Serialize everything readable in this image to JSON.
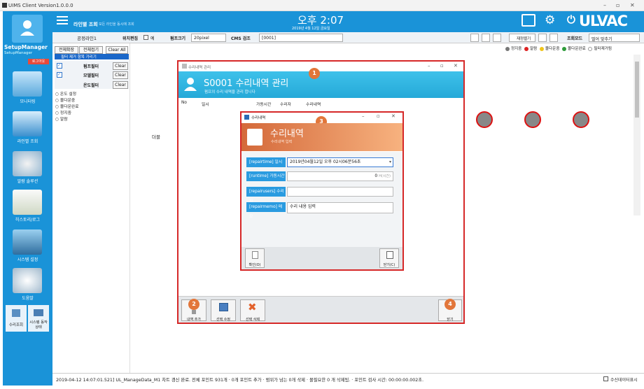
{
  "app_title": "UIMS Client Version1.0.0.0",
  "sidebar": {
    "user_name": "SetupManager",
    "user_sub": "SetupManager",
    "logout": "로그아웃",
    "items": [
      {
        "label": "모니터링"
      },
      {
        "label": "라인별 조회"
      },
      {
        "label": "알람 솔루션"
      },
      {
        "label": "히스토리/로그"
      },
      {
        "label": "시스템 설정"
      },
      {
        "label": "도움말"
      }
    ],
    "bottom_items": [
      {
        "label": "수리조회"
      },
      {
        "label": "시스템 동작상태"
      }
    ]
  },
  "header": {
    "page_title": "라인별 조회",
    "page_sub": "모든 라인을 동시에 조회",
    "clock": "오후 2:07",
    "date": "2019년 4월 12일 금요일",
    "brand": "ULVAC"
  },
  "toolbar": {
    "line": "공정라인1",
    "edit_label": "위치편집",
    "edit_value": "예",
    "pump_size_label": "펌프크기",
    "pump_size": "20pixel",
    "cms_label": "CMS 검조",
    "cms_value": "[0001]",
    "btn_refresh": "재정렬기",
    "mode_label": "조회모드",
    "mode_value": "멀어 맞추기"
  },
  "legend": [
    {
      "label": "정지중",
      "color": "#777777"
    },
    {
      "label": "알람",
      "color": "#dd2222"
    },
    {
      "label": "몰다운중",
      "color": "#f0c419"
    },
    {
      "label": "몰다운완료",
      "color": "#2e9b3a"
    },
    {
      "label": "필터제거됨",
      "color": "#ffffff"
    }
  ],
  "left_panel": {
    "btn_expand": "전체확장",
    "btn_collapse": "전체접기",
    "btn_clear_all": "Clear All",
    "filter_hint": "필터 제거 항목 가리기",
    "filters": [
      {
        "label": "펌프필터",
        "action": "Clear"
      },
      {
        "label": "모델필터",
        "action": "Clear"
      },
      {
        "label": "온도필터",
        "action": "Clear"
      }
    ],
    "radios": [
      "온도 설정",
      "몰다운중",
      "몰다운완료",
      "정지중",
      "알람"
    ],
    "tail_label": "더블"
  },
  "outer_dialog": {
    "window_title": "수리내역 관리",
    "title": "S0001 수리내역 관리",
    "subtitle": "펌프의 수리 내역을 관리 합니다",
    "columns": [
      "No",
      "일시",
      "가동시간",
      "수리자",
      "수리내역"
    ],
    "btn_add": "내역 추가",
    "btn_edit": "선택 수정",
    "btn_delete": "선택 삭제",
    "btn_close": "닫기",
    "badge1": "1",
    "badge2": "2",
    "badge4": "4"
  },
  "inner_dialog": {
    "window_title": "수리내역",
    "title": "수리내역",
    "subtitle": "수리내역 입력",
    "badge": "3",
    "fields": [
      {
        "label": "[repairtime] 일시",
        "value": "2019년04월12일 오후 02시06분56초"
      },
      {
        "label": "[runtime] 가동시간",
        "value": "0",
        "unit": "H(시간)"
      },
      {
        "label": "[repairusers] 수리자",
        "value": ""
      },
      {
        "label": "[repairmemo] 메모",
        "value": "수리 내용 입력"
      }
    ],
    "btn_ok": "확인(O)",
    "btn_close": "닫기(C)"
  },
  "status": {
    "log": "2019-04-12 14:07:01.521] UL_ManageData_M1 차트 갱신 완료. 전체 포인트 931개 · 0개 포인트 추가 · 범위가 넘는 0개 삭제 · 몰필요한 0 개 삭제됨. · 포인트 검사 시간: 00:00:00.002초.",
    "check_label": "수신데이터표시"
  }
}
